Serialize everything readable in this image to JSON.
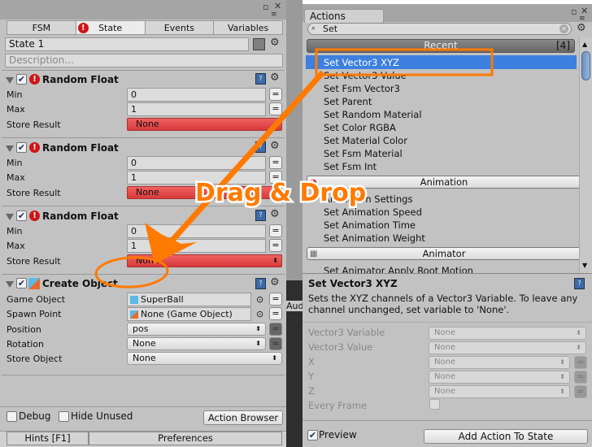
{
  "fsm_panel": {
    "tabs": [
      {
        "label": "FSM"
      },
      {
        "label": "State",
        "error": true
      },
      {
        "label": "Events"
      },
      {
        "label": "Variables"
      }
    ],
    "state_name": "State 1",
    "description_placeholder": "Description...",
    "state_color": "#7f7f7f",
    "actions": [
      {
        "title": "Random Float",
        "rows": [
          {
            "label": "Min",
            "value": "0"
          },
          {
            "label": "Max",
            "value": "1"
          },
          {
            "label": "Store Result",
            "value": "None",
            "error": true
          }
        ]
      },
      {
        "title": "Random Float",
        "rows": [
          {
            "label": "Min",
            "value": "0"
          },
          {
            "label": "Max",
            "value": "1"
          },
          {
            "label": "Store Result",
            "value": "None",
            "error": true
          }
        ]
      },
      {
        "title": "Random Float",
        "rows": [
          {
            "label": "Min",
            "value": "0"
          },
          {
            "label": "Max",
            "value": "1"
          },
          {
            "label": "Store Result",
            "value": "None",
            "error": true
          }
        ]
      }
    ],
    "create_object": {
      "title": "Create Object",
      "rows": [
        {
          "label": "Game Object",
          "value": "SuperBall"
        },
        {
          "label": "Spawn Point",
          "value": "None (Game Object)"
        },
        {
          "label": "Position",
          "value": "pos"
        },
        {
          "label": "Rotation",
          "value": "None"
        },
        {
          "label": "Store Object",
          "value": "None"
        }
      ]
    },
    "debug_label": "Debug",
    "hide_unused_label": "Hide Unused",
    "action_browser_label": "Action Browser",
    "hints_label": "Hints [F1]",
    "preferences_label": "Preferences"
  },
  "actions_panel": {
    "tab": "Actions",
    "search_value": "Set",
    "recent_label": "Recent",
    "recent_count": "[4]",
    "recent_items": [
      "Set Vector3 XYZ",
      "Set Vector3 Value",
      "Set Fsm Vector3",
      "Set Parent",
      "Set Random Material",
      "Set Color RGBA",
      "Set Material Color",
      "Set Fsm Material",
      "Set Fsm Int"
    ],
    "animation_label": "Animation",
    "animation_items": [
      "Animation Settings",
      "Set Animation Speed",
      "Set Animation Time",
      "Set Animation Weight"
    ],
    "animator_label": "Animator",
    "animator_items": [
      "Set Animator Apply Root Motion"
    ],
    "selected_item": "Set Vector3 XYZ",
    "selection_color": "#3d80df",
    "detail": {
      "title": "Set Vector3 XYZ",
      "description": "Sets the XYZ channels of a Vector3 Variable. To leave any channel unchanged, set variable to 'None'.",
      "rows": [
        {
          "label": "Vector3 Variable",
          "value": "None"
        },
        {
          "label": "Vector3 Value",
          "value": "None"
        },
        {
          "label": "X",
          "value": "None"
        },
        {
          "label": "Y",
          "value": "None"
        },
        {
          "label": "Z",
          "value": "None"
        },
        {
          "label": "Every Frame",
          "value": ""
        }
      ]
    },
    "preview_label": "Preview",
    "add_action_label": "Add Action To State"
  },
  "background_tab_fragment": "Audi",
  "annotation": {
    "text": "Drag & Drop",
    "color": "#ff7a00"
  }
}
